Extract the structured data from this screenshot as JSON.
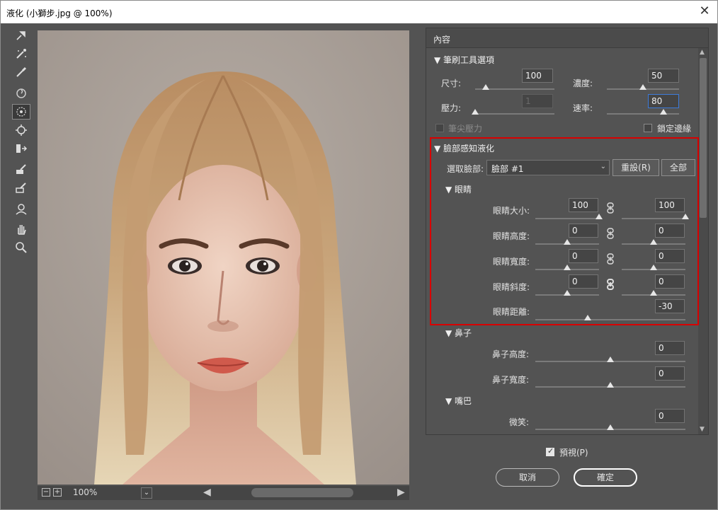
{
  "window": {
    "title": "液化 (小獅步.jpg @ 100%)",
    "close_glyph": "✕"
  },
  "tools": [
    {
      "name": "forward-warp-icon",
      "active": false
    },
    {
      "name": "reconstruct-icon",
      "active": false
    },
    {
      "name": "smooth-icon",
      "active": false
    },
    {
      "name": "twirl-icon",
      "active": false
    },
    {
      "name": "pucker-icon",
      "active": true
    },
    {
      "name": "bloat-icon",
      "active": false
    },
    {
      "name": "push-left-icon",
      "active": false
    },
    {
      "name": "freeze-mask-icon",
      "active": false
    },
    {
      "name": "thaw-mask-icon",
      "active": false
    },
    {
      "name": "face-tool-icon",
      "active": false
    },
    {
      "name": "hand-icon",
      "active": false
    },
    {
      "name": "zoom-icon",
      "active": false
    }
  ],
  "bottombar": {
    "zoom_out": "−",
    "zoom_in": "+",
    "zoom": "100%",
    "dropdown": "⌄",
    "left": "◀",
    "right": "▶"
  },
  "panel": {
    "title": "內容",
    "brush": {
      "header": "▼ 筆刷工具選項",
      "size_label": "尺寸:",
      "size_value": "100",
      "size_pos": 0.13,
      "density_label": "濃度:",
      "density_value": "50",
      "density_pos": 0.5,
      "pressure_label": "壓力:",
      "pressure_value": "1",
      "pressure_pos": 0.0,
      "rate_label": "速率:",
      "rate_value": "80",
      "rate_pos": 0.78,
      "pen_pressure_label": "筆尖壓力",
      "pin_edges_label": "鎖定邊緣"
    },
    "face": {
      "header": "▼ 臉部感知液化",
      "select_label": "選取臉部:",
      "select_value": "臉部 #1",
      "reset_label": "重設(R)",
      "all_label": "全部",
      "eyes": {
        "header": "▼ 眼睛",
        "rows": [
          {
            "label": "眼睛大小:",
            "left_value": "100",
            "right_value": "100",
            "left_pos": 1.0,
            "right_pos": 1.0,
            "linked": false
          },
          {
            "label": "眼睛高度:",
            "left_value": "0",
            "right_value": "0",
            "left_pos": 0.5,
            "right_pos": 0.5,
            "linked": false
          },
          {
            "label": "眼睛寬度:",
            "left_value": "0",
            "right_value": "0",
            "left_pos": 0.5,
            "right_pos": 0.5,
            "linked": false
          },
          {
            "label": "眼睛斜度:",
            "left_value": "0",
            "right_value": "0",
            "left_pos": 0.5,
            "right_pos": 0.5,
            "linked": true
          }
        ],
        "distance_label": "眼睛距離:",
        "distance_value": "-30",
        "distance_pos": 0.35
      },
      "nose": {
        "header": "▼ 鼻子",
        "height_label": "鼻子高度:",
        "height_value": "0",
        "height_pos": 0.5,
        "width_label": "鼻子寬度:",
        "width_value": "0",
        "width_pos": 0.5
      },
      "mouth": {
        "header": "▼ 嘴巴",
        "smile_label": "微笑:",
        "smile_value": "0",
        "smile_pos": 0.5
      }
    }
  },
  "dialog": {
    "preview_label": "預視(P)",
    "cancel_label": "取消",
    "ok_label": "確定"
  },
  "colors": {
    "highlight": "#d80000",
    "panel": "#535353",
    "focus": "#3d7bd9"
  }
}
